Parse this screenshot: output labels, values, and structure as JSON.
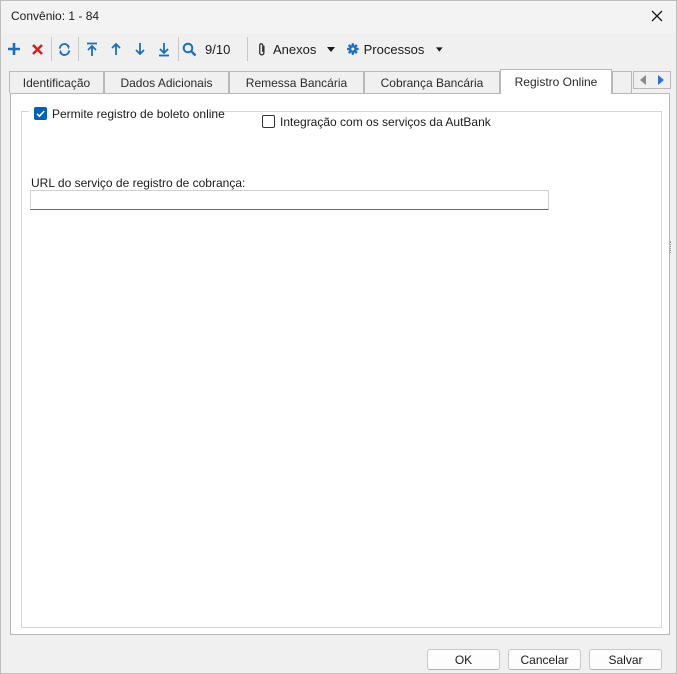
{
  "window": {
    "title": "Convênio: 1 - 84"
  },
  "toolbar": {
    "record_position": "9/10",
    "attachments_label": "Anexos",
    "processes_label": "Processos"
  },
  "tabs": [
    {
      "label": "Identificação"
    },
    {
      "label": "Dados Adicionais"
    },
    {
      "label": "Remessa Bancária"
    },
    {
      "label": "Cobrança Bancária"
    },
    {
      "label": "Registro Online",
      "active": true
    }
  ],
  "registro": {
    "allow_online_label": "Permite registro de boleto online",
    "allow_online_checked": true,
    "autbank_label": "Integração com os serviços da AutBank",
    "autbank_checked": false,
    "url_label": "URL do serviço de registro de cobrança:",
    "url_value": ""
  },
  "footer": {
    "ok_label": "OK",
    "cancel_label": "Cancelar",
    "save_label": "Salvar"
  },
  "colors": {
    "accent": "#005fb8",
    "toolbar_icon": "#1b6fbf",
    "delete_icon": "#d32020"
  }
}
